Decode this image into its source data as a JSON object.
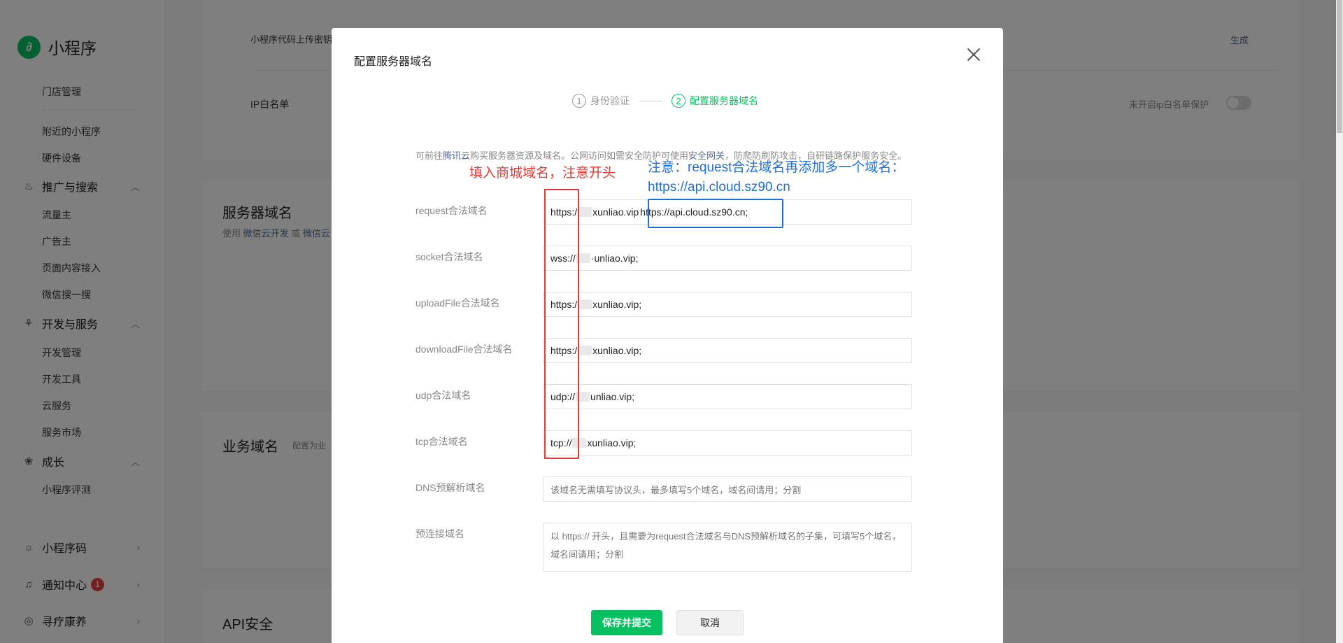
{
  "sidebar": {
    "logo_mark": "∂",
    "app_name": "小程序",
    "item_store": "门店管理",
    "item_nearby": "附近的小程序",
    "item_hardware": "硬件设备",
    "group_promo": "推广与搜索",
    "item_traffic": "流量主",
    "item_ads": "广告主",
    "item_content": "页面内容接入",
    "item_wxsearch": "微信搜一搜",
    "group_dev": "开发与服务",
    "item_devmgmt": "开发管理",
    "item_devtools": "开发工具",
    "item_cloud": "云服务",
    "item_market": "服务市场",
    "group_growth": "成长",
    "item_eval": "小程序评测",
    "group_qrcode": "小程序码",
    "group_notify": "通知中心",
    "notify_count": "1",
    "account_name": "寻疗康养",
    "icons": {
      "promo": "flame-icon",
      "dev": "services-icon",
      "growth": "growth-icon",
      "qrcode": "sun-icon",
      "notify": "bell-icon",
      "chevron_up": "chevron-up-icon",
      "chevron_right": "chevron-right-icon"
    }
  },
  "background": {
    "code_upload_label": "小程序代码上传密钥",
    "generate_link": "生成",
    "ip_whitelist_label": "IP白名单",
    "ip_whitelist_status": "未开启ip白名单保护",
    "server_domain_title": "服务器域名",
    "server_domain_sub_prefix": "使用",
    "server_domain_sub_link1": "微信云开发",
    "server_domain_sub_or": "或",
    "server_domain_sub_link2": "微信云",
    "biz_domain_title": "业务域名",
    "biz_domain_sub": "配置为业",
    "api_security_title": "API安全"
  },
  "dialog": {
    "title": "配置服务器域名",
    "steps": [
      {
        "num": "1",
        "label": "身份验证"
      },
      {
        "num": "2",
        "label": "配置服务器域名"
      }
    ],
    "intro": {
      "p1": "可前往",
      "link1": "腾讯云",
      "p2": "购买服务器资源及域名。公网访问如需安全防护可使用",
      "link2": "安全网关",
      "p3": "，防爬防刷防攻击，自研链路保护服务安全。"
    },
    "fields": {
      "request": {
        "label": "request合法域名",
        "prefix": "https:/",
        "suffix": "xunliao.vip"
      },
      "socket": {
        "label": "socket合法域名",
        "prefix": "wss://",
        "suffix": "·unliao.vip;"
      },
      "upload": {
        "label": "uploadFile合法域名",
        "prefix": "https:/",
        "suffix": "xunliao.vip;"
      },
      "download": {
        "label": "downloadFile合法域名",
        "prefix": "https:/",
        "suffix": "xunliao.vip;"
      },
      "udp": {
        "label": "udp合法域名",
        "prefix": "udp://",
        "suffix": "unliao.vip;"
      },
      "tcp": {
        "label": "tcp合法域名",
        "prefix": "tcp://",
        "suffix": "xunliao.vip;"
      },
      "dns": {
        "label": "DNS预解析域名",
        "placeholder": "该域名无需填写协议头，最多填写5个域名，域名间请用；分割"
      },
      "preconnect": {
        "label": "预连接域名",
        "placeholder": "以 https:// 开头，且需要为request合法域名与DNS预解析域名的子集，可填写5个域名，域名间请用；分割"
      }
    },
    "submit_label": "保存并提交",
    "cancel_label": "取消"
  },
  "annotations": {
    "red_note": "填入商城域名，注意开头",
    "blue_note_line1": "注意：request合法域名再添加多一个域名：",
    "blue_note_line2": "https://api.cloud.sz90.cn",
    "added_domain": "https://api.cloud.sz90.cn;"
  },
  "colors": {
    "brand_green": "#07c160",
    "link_blue": "#576b95",
    "annotation_red": "#e53935",
    "annotation_blue": "#1e6fd9",
    "badge_red": "#e64340"
  }
}
